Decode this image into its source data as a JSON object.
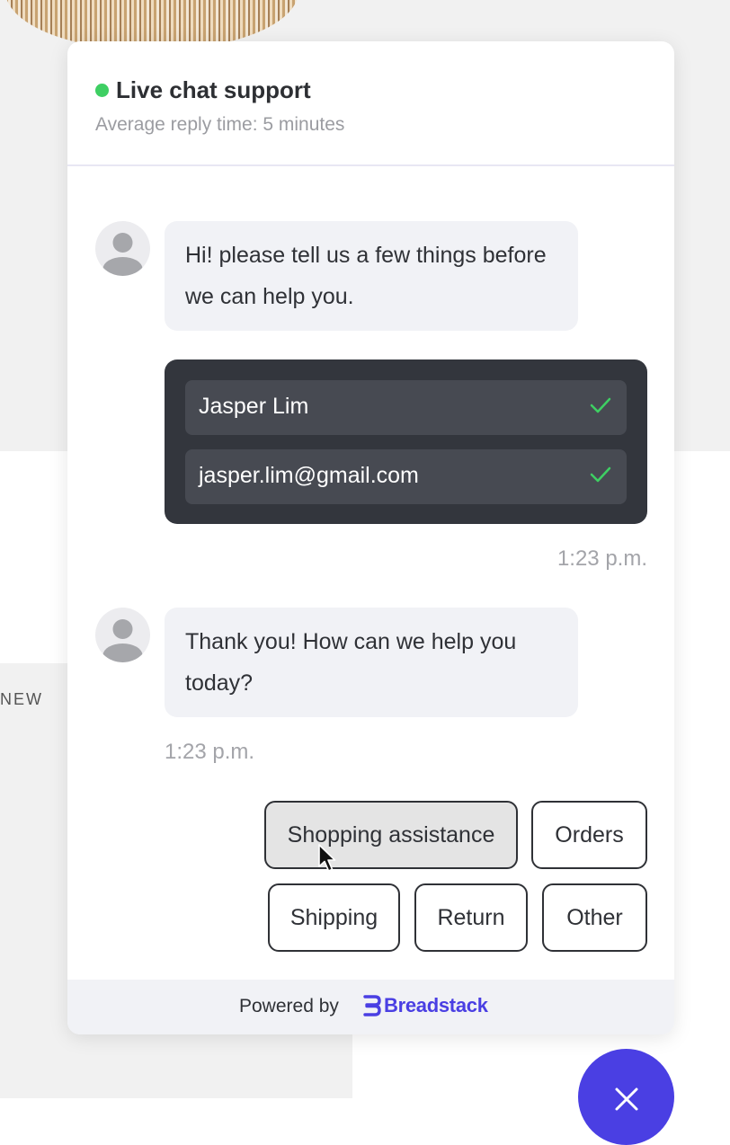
{
  "background": {
    "new_label": "NEW"
  },
  "colors": {
    "online": "#3ecf63",
    "accent": "#4a3fe3",
    "form_card": "#33363d",
    "check": "#3ecf63"
  },
  "header": {
    "title": "Live chat support",
    "subtitle": "Average reply time: 5 minutes"
  },
  "messages": [
    {
      "from": "agent",
      "text": "Hi! please tell us a few things before we can help you."
    },
    {
      "from": "user-form",
      "fields": [
        {
          "value": "Jasper Lim",
          "icon": "check-icon"
        },
        {
          "value": "jasper.lim@gmail.com",
          "icon": "check-icon"
        }
      ],
      "time": "1:23 p.m."
    },
    {
      "from": "agent",
      "text": "Thank you! How can we help you today?",
      "time": "1:23 p.m."
    }
  ],
  "quick_replies": [
    {
      "label": "Shopping assistance",
      "hovered": true
    },
    {
      "label": "Orders"
    },
    {
      "label": "Shipping"
    },
    {
      "label": "Return"
    },
    {
      "label": "Other"
    }
  ],
  "footer": {
    "powered_by": "Powered by",
    "brand": "Breadstack"
  },
  "fab": {
    "icon": "close-icon"
  }
}
